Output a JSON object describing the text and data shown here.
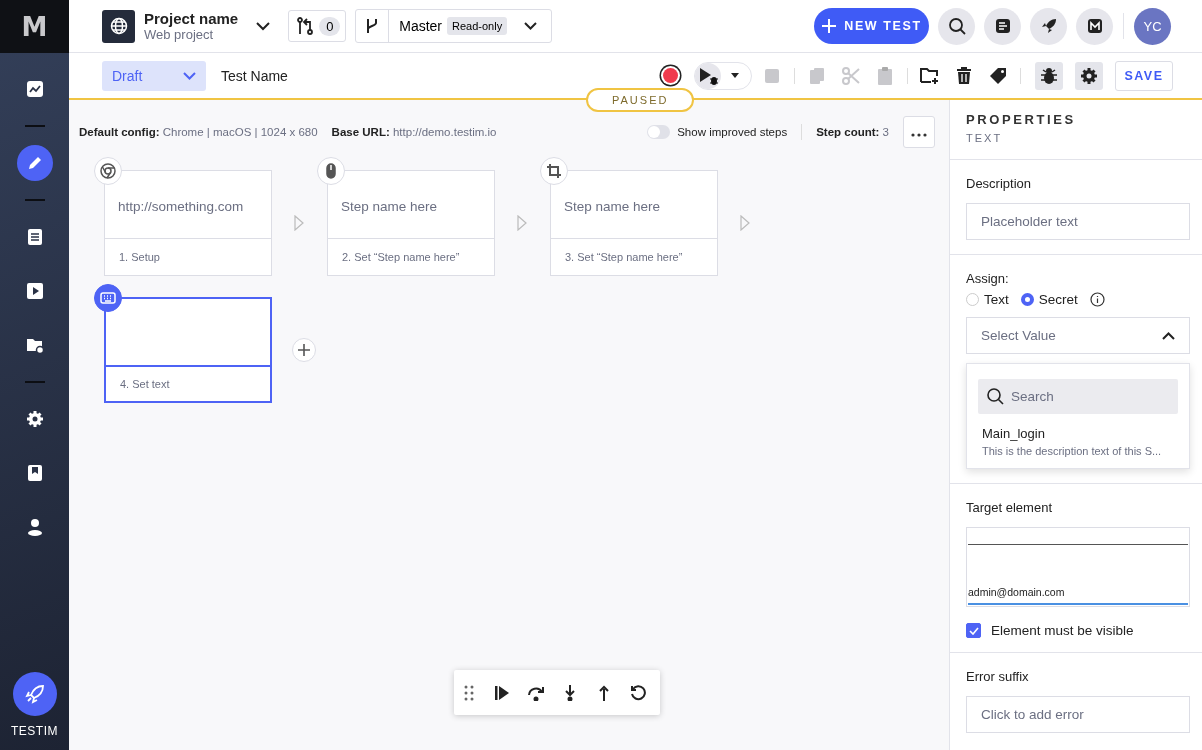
{
  "sidebar": {
    "logo": "M",
    "groups": [
      {
        "items": [
          {
            "kind": "chart",
            "selected": false
          }
        ]
      },
      {
        "items": [
          {
            "kind": "edit",
            "selected": true
          }
        ]
      },
      {
        "items": [
          {
            "kind": "list",
            "selected": false
          },
          {
            "kind": "play",
            "selected": false
          },
          {
            "kind": "folder",
            "selected": false
          }
        ]
      },
      {
        "items": [
          {
            "kind": "gear",
            "selected": false
          },
          {
            "kind": "bookmark",
            "selected": false
          },
          {
            "kind": "user",
            "selected": false
          }
        ]
      }
    ],
    "brand": "TESTIM"
  },
  "header": {
    "project_name": "Project name",
    "project_type": "Web project",
    "branch_count": "0",
    "branch": "Master",
    "branch_badge": "Read-only",
    "new_test": "NEW TEST",
    "avatar": "YC"
  },
  "toolbar": {
    "status": "Draft",
    "test_name": "Test Name",
    "save": "SAVE",
    "run_state": "PAUSED"
  },
  "info": {
    "config_label": "Default config:",
    "config_value": "Chrome | macOS | 1024 x 680",
    "url_label": "Base URL:",
    "url_value": "http://demo.testim.io",
    "toggle_label": "Show improved steps",
    "toggle_on": false,
    "count_label": "Step count:",
    "count_value": "3"
  },
  "steps": [
    {
      "kind": "browser",
      "title": "http://something.com",
      "caption": "1. Setup",
      "selected": false
    },
    {
      "kind": "mouse",
      "title": "Step name here",
      "caption": "2. Set “Step name here”",
      "selected": false
    },
    {
      "kind": "crop",
      "title": "Step name here",
      "caption": "3. Set “Step name here”",
      "selected": false
    },
    {
      "kind": "keyboard",
      "caption": "4. Set text",
      "selected": true
    }
  ],
  "properties": {
    "title": "PROPERTIES",
    "subtitle": "TEXT",
    "description_label": "Description",
    "description_placeholder": "Placeholder text",
    "assign_label": "Assign:",
    "assign_options": [
      {
        "label": "Text",
        "selected": false
      },
      {
        "label": "Secret",
        "selected": true
      }
    ],
    "select_placeholder": "Select Value",
    "search_placeholder": "Search",
    "options": [
      {
        "name": "Main_login",
        "description": "This is the description text of this S..."
      }
    ],
    "target_label": "Target element",
    "target_text": "admin@domain.com",
    "visible_label": "Element must be visible",
    "visible_checked": true,
    "error_label": "Error suffix",
    "error_placeholder": "Click to add error"
  }
}
